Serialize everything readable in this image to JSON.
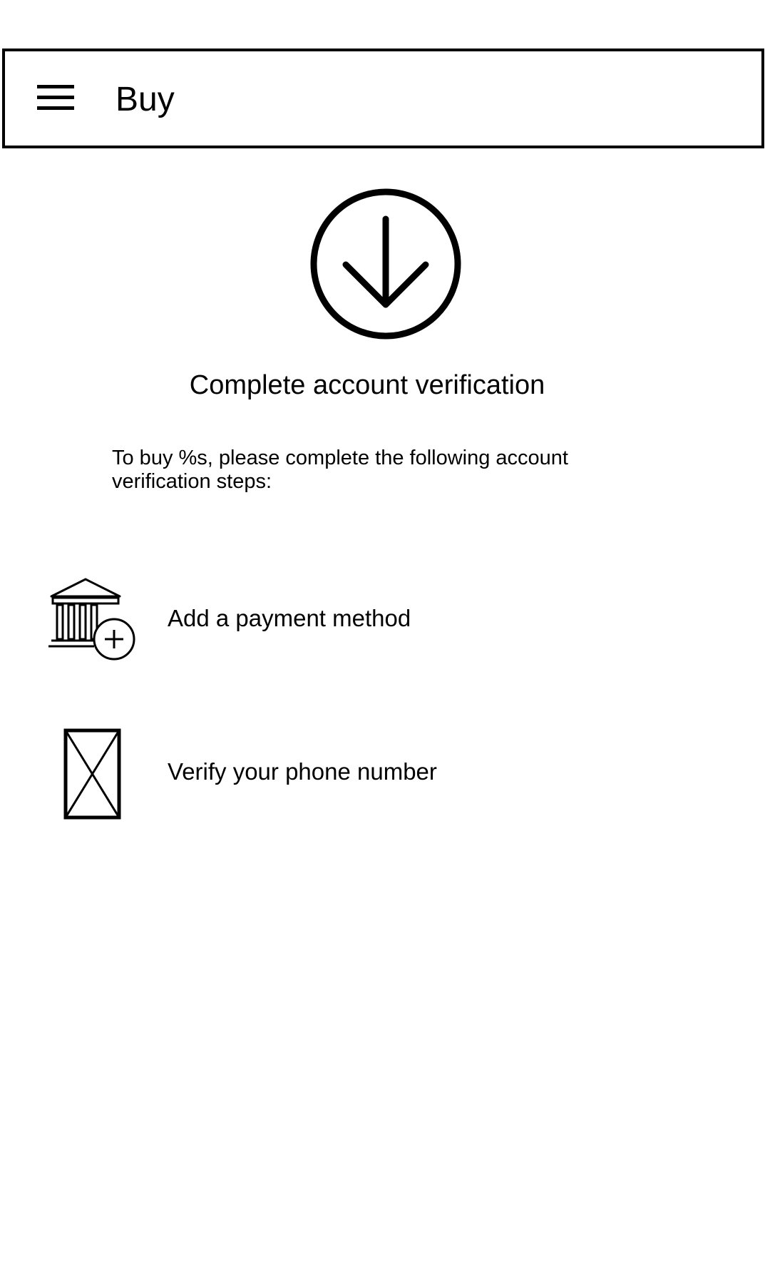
{
  "app_bar": {
    "title": "Buy",
    "menu_icon": "hamburger-menu-icon"
  },
  "hero": {
    "icon": "arrow-down-circle-icon",
    "heading": "Complete account verification",
    "description": "To buy %s, please complete the following account verification steps:"
  },
  "steps": [
    {
      "icon": "bank-add-icon",
      "label": "Add a payment method"
    },
    {
      "icon": "image-placeholder-icon",
      "label": "Verify your phone number"
    }
  ],
  "colors": {
    "background": "#ffffff",
    "foreground": "#000000"
  }
}
